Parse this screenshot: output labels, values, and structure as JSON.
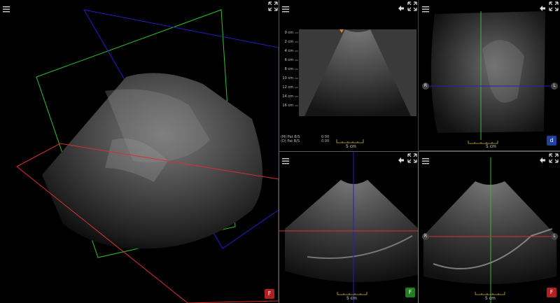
{
  "icons": {
    "menu": "hamburger-menu-icon",
    "expand": "expand-arrows-icon",
    "back": "back-arrow-icon"
  },
  "panes": {
    "volume_3d": {
      "badge": "F"
    },
    "bmode": {
      "depth_labels": [
        "0 cm",
        "2 cm",
        "4 cm",
        "6 cm",
        "8 cm",
        "10 cm",
        "12 cm",
        "14 cm",
        "16 cm"
      ],
      "info_line1": "(M) Pat B/S",
      "info_line2": "(D) Pat B/S",
      "info_val1": "0.00",
      "info_val2": "0.00",
      "scale": "5 cm"
    },
    "top_right": {
      "left_orient": "R",
      "right_orient": "L",
      "scale": "5 cm",
      "badge": "d"
    },
    "bottom_left": {
      "scale": "5 cm",
      "badge": "F"
    },
    "bottom_right": {
      "left_orient": "R",
      "right_orient": "L",
      "scale": "5 cm",
      "badge": "F"
    }
  },
  "colors": {
    "red_plane": "#d83030",
    "green_plane": "#30c030",
    "blue_plane": "#2020c0",
    "divider": "#5a5a5a",
    "marker": "#e08020"
  }
}
